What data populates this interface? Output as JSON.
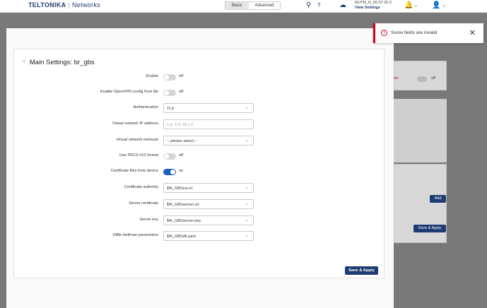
{
  "header": {
    "brand": "TELTONIKA",
    "brand_sep": "|",
    "brand_sub": "Networks",
    "mode_basic": "Basic",
    "mode_advanced": "Advanced",
    "firmware": "RUTM_R_00.07.05.3",
    "view_settings": "View Settings"
  },
  "background": {
    "delete_label": "delete",
    "toggle_state": "off",
    "add_label": "Add",
    "save_apply": "Save & Apply"
  },
  "panel": {
    "title": "Main Settings: br_gbs",
    "rows": [
      {
        "label": "Enable",
        "state": "off"
      },
      {
        "label": "Enable OpenVPN config from file",
        "state": "off"
      },
      {
        "label": "Authentication",
        "value": "TLS"
      },
      {
        "label": "Virtual network IP address",
        "placeholder": "e.g. 172.16.1.0"
      },
      {
        "label": "Virtual network netmask",
        "value": "-- please select --"
      },
      {
        "label": "Use PKCS #12 format",
        "state": "off"
      },
      {
        "label": "Certificate files from device",
        "state": "on"
      },
      {
        "label": "Certificate authority",
        "value": "BR_GBSca.crt"
      },
      {
        "label": "Server certificate",
        "value": "BR_GBSserver.crt"
      },
      {
        "label": "Server key",
        "value": "BR_GBSserver.key"
      },
      {
        "label": "Diffie Hellman parameters",
        "value": "BR_GBSdh.pem"
      }
    ],
    "save_label": "Save & Apply"
  },
  "toast": {
    "message": "Some fields are invalid",
    "icon": "!",
    "close": "✕"
  },
  "colors": {
    "brand": "#1f3b73",
    "toggle_on": "#1f5fbf",
    "error": "#d0021b"
  }
}
